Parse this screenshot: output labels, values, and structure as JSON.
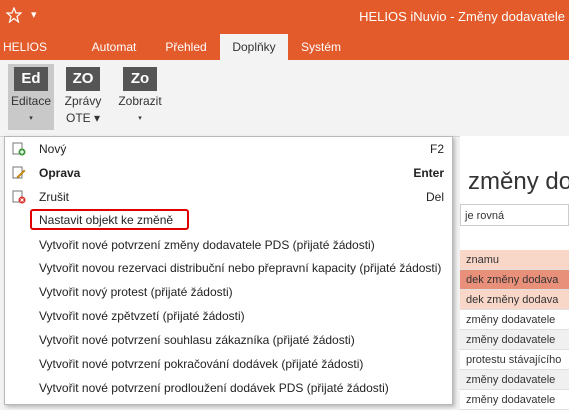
{
  "window": {
    "title": "HELIOS iNuvio - Změny dodavatele",
    "app_icon": "helios-star-icon",
    "quick_access": "▾"
  },
  "tabs": [
    {
      "label": "HELIOS",
      "active": false
    },
    {
      "label": "Automat",
      "active": false
    },
    {
      "label": "Přehled",
      "active": false
    },
    {
      "label": "Doplňky",
      "active": true
    },
    {
      "label": "Systém",
      "active": false
    }
  ],
  "ribbon": {
    "buttons": [
      {
        "icon_text": "Ed",
        "label_line1": "Editace",
        "label_line2": "▾",
        "active": true
      },
      {
        "icon_text": "ZO",
        "label_line1": "Zprávy",
        "label_line2": "OTE ▾",
        "active": false
      },
      {
        "icon_text": "Zo",
        "label_line1": "Zobrazit",
        "label_line2": "▾",
        "active": false
      }
    ]
  },
  "menu": {
    "items": [
      {
        "label": "Nový",
        "shortcut": "F2",
        "bold": false,
        "icon": "new-record-icon"
      },
      {
        "label": "Oprava",
        "shortcut": "Enter",
        "bold": true,
        "icon": "edit-pencil-icon"
      },
      {
        "label": "Zrušit",
        "shortcut": "Del",
        "bold": false,
        "icon": "delete-icon"
      },
      {
        "label": "Nastavit objekt ke změně",
        "shortcut": "",
        "bold": false,
        "icon": "",
        "highlighted": true
      },
      {
        "label": "Vytvořit nové potvrzení změny dodavatele PDS (přijaté žádosti)",
        "shortcut": "",
        "bold": false,
        "icon": ""
      },
      {
        "label": "Vytvořit novou rezervaci distribuční nebo přepravní kapacity (přijaté žádosti)",
        "shortcut": "",
        "bold": false,
        "icon": ""
      },
      {
        "label": "Vytvořit nový protest (přijaté žádosti)",
        "shortcut": "",
        "bold": false,
        "icon": ""
      },
      {
        "label": "Vytvořit nové zpětvzetí (přijaté žádosti)",
        "shortcut": "",
        "bold": false,
        "icon": ""
      },
      {
        "label": "Vytvořit nové potvrzení souhlasu zákazníka (přijaté žádosti)",
        "shortcut": "",
        "bold": false,
        "icon": ""
      },
      {
        "label": "Vytvořit nové potvrzení pokračování dodávek (přijaté žádosti)",
        "shortcut": "",
        "bold": false,
        "icon": ""
      },
      {
        "label": "Vytvořit nové potvrzení prodloužení dodávek PDS (přijaté žádosti)",
        "shortcut": "",
        "bold": false,
        "icon": ""
      }
    ]
  },
  "background_panel": {
    "title": "změny dod",
    "filter_text": "je rovná",
    "rows": [
      {
        "text": "znamu",
        "color": "#f8d7c8"
      },
      {
        "text": "dek změny dodava",
        "color": "#e9907a"
      },
      {
        "text": "dek změny dodava",
        "color": "#f8d7c8"
      },
      {
        "text": "změny dodavatele",
        "color": "#ffffff"
      },
      {
        "text": "změny dodavatele",
        "color": "#f0f0f0"
      },
      {
        "text": "protestu stávajícího",
        "color": "#ffffff"
      },
      {
        "text": "změny dodavatele",
        "color": "#f0f0f0"
      },
      {
        "text": "změny dodavatele",
        "color": "#ffffff"
      }
    ]
  },
  "colors": {
    "brand": "#e35a2b",
    "highlight_border": "#e00000",
    "ribbon_icon": "#555555"
  }
}
